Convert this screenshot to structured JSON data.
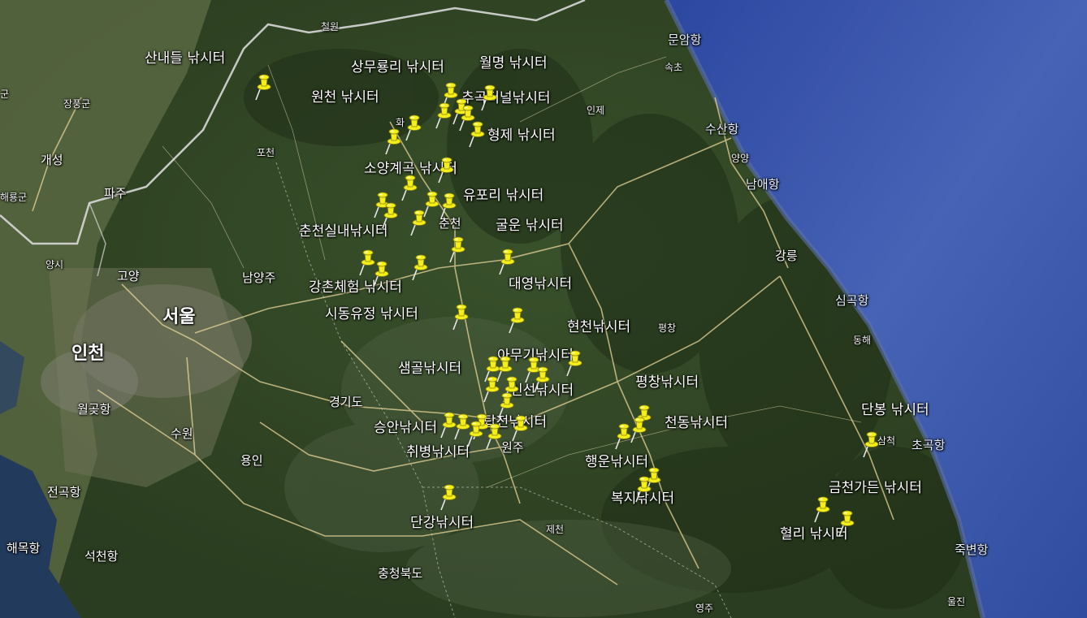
{
  "colors": {
    "sea": "#3b5aa8",
    "land": "#3a4a2a",
    "pin": "#f4ef1a",
    "road": "#e8d59a",
    "border": "#d8d8d8"
  },
  "fishing_sites": [
    "산내들 낚시터",
    "상무룡리 낚시터",
    "월명 낚시터",
    "원천 낚시터",
    "추곡터널낚시터",
    "형제 낚시터",
    "소양계곡 낚시터",
    "유포리 낚시터",
    "굴운 낚시터",
    "춘천실내낚시터",
    "대영낚시터",
    "강촌체험 낚시터",
    "시동유정 낚시터",
    "현천낚시터",
    "아무기낚시터",
    "샘골낚시터",
    "평창낚시터",
    "신선낚시터",
    "탑전낚시터",
    "천동낚시터",
    "승안낚시터",
    "취병낚시터",
    "행운낚시터",
    "단봉 낚시터",
    "복지낚시터",
    "금천가든 낚시터",
    "단강낚시터",
    "혈리 낚시터"
  ],
  "places": [
    "철원",
    "군",
    "장풍군",
    "포천",
    "개성",
    "파주",
    "해룡군",
    "양시",
    "고양",
    "남양주",
    "서울",
    "인천",
    "월곶항",
    "수원",
    "용인",
    "경기도",
    "전곡항",
    "해목항",
    "석천항",
    "충청북도",
    "제천",
    "원주",
    "춘천",
    "인제",
    "속초",
    "문암항",
    "수산항",
    "양양",
    "남애항",
    "강릉",
    "심곡항",
    "동해",
    "삼척",
    "초곡항",
    "죽변항",
    "울진",
    "평창",
    "영주",
    "화"
  ]
}
